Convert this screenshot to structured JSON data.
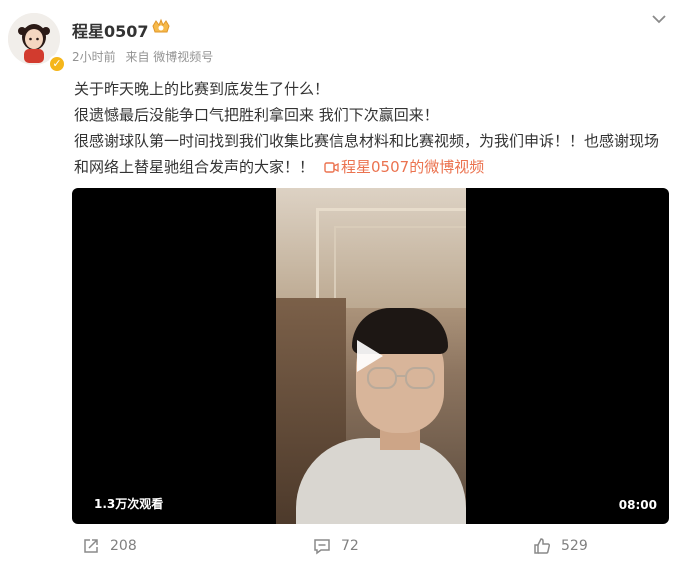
{
  "post": {
    "username": "程星0507",
    "time": "2小时前",
    "source": "来自 微博视频号",
    "lines": [
      "关于昨天晚上的比赛到底发生了什么！",
      "很遗憾最后没能争口气把胜利拿回来 我们下次赢回来！",
      "很感谢球队第一时间找到我们收集比赛信息材料和比赛视频，为我们申诉！！也感谢现场和网络上替星驰组合发声的大家！！"
    ],
    "video_link": "程星0507的微博视频"
  },
  "video": {
    "views": "1.3万次观看",
    "duration": "08:00"
  },
  "actions": {
    "share_count": "208",
    "comment_count": "72",
    "like_count": "529"
  },
  "colors": {
    "link": "#eb7350",
    "text": "#333333",
    "muted": "#939393",
    "verified": "#f5b61a"
  },
  "icons": [
    "avatar",
    "verified-badge-icon",
    "fan-badge-icon",
    "chevron-down-icon",
    "video-link-icon",
    "play-icon",
    "share-icon",
    "comment-icon",
    "like-icon"
  ]
}
